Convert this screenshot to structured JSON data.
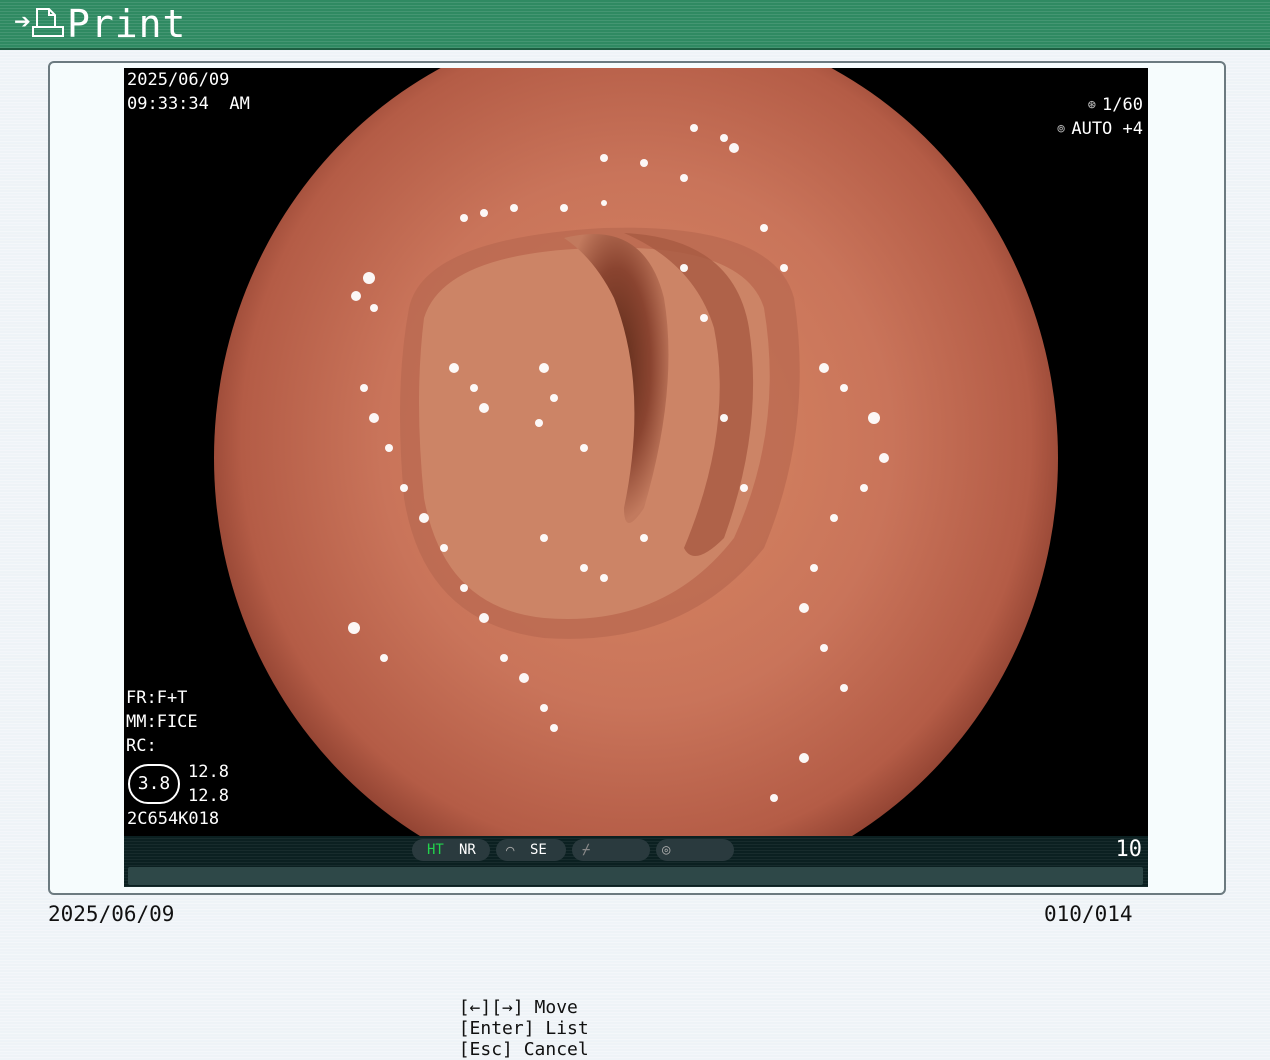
{
  "header": {
    "title": "Print",
    "arrow_icon": "arrow-right-icon",
    "doc_icon": "document-icon"
  },
  "screen": {
    "date": "2025/06/09",
    "time": "09:33:34  AM",
    "shutter_speed": "1/60",
    "exposure": "AUTO +4",
    "settings": [
      "FR:F+T",
      "MM:FICE",
      "RC:"
    ],
    "badge_value": "3.8",
    "values": [
      "12.8",
      "12.8"
    ],
    "serial": "2C654K018"
  },
  "statusbar": {
    "ht": "HT",
    "nr": "NR",
    "se": "SE",
    "frame_number": "10",
    "colors": {
      "ht": "#22d24c",
      "text": "#ffffff"
    }
  },
  "footer": {
    "date": "2025/06/09",
    "counter": "010/014",
    "hints": [
      "[←][→] Move",
      "[Enter] List",
      "[Esc] Cancel"
    ]
  }
}
